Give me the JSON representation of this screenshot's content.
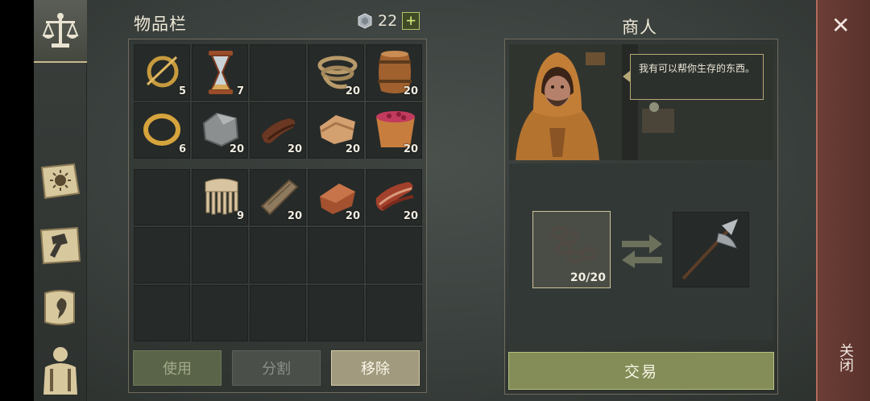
{
  "inventory": {
    "title": "物品栏",
    "currency": {
      "icon": "silver-coin-icon",
      "amount": "22",
      "add_label": "+"
    },
    "bag_slots": [
      {
        "icon": "brooch-icon",
        "qty": "5"
      },
      {
        "icon": "hourglass-icon",
        "qty": "7"
      },
      {
        "icon": "",
        "qty": ""
      },
      {
        "icon": "rope-icon",
        "qty": "20"
      },
      {
        "icon": "barrel-icon",
        "qty": "20"
      },
      {
        "icon": "gold-ring-icon",
        "qty": "6"
      },
      {
        "icon": "stone-icon",
        "qty": "20"
      },
      {
        "icon": "leather-strap-icon",
        "qty": "20"
      },
      {
        "icon": "cloth-icon",
        "qty": "20"
      },
      {
        "icon": "berry-bucket-icon",
        "qty": "20"
      }
    ],
    "stash_slots": [
      {
        "icon": "",
        "qty": ""
      },
      {
        "icon": "comb-icon",
        "qty": "9"
      },
      {
        "icon": "wooden-plank-icon",
        "qty": "20"
      },
      {
        "icon": "copper-ingot-icon",
        "qty": "20"
      },
      {
        "icon": "meat-icon",
        "qty": "20"
      }
    ],
    "buttons": {
      "use": "使用",
      "split": "分割",
      "remove": "移除"
    }
  },
  "merchant": {
    "title": "商人",
    "dialogue": "我有可以帮你生存的东西。",
    "offer": {
      "icon": "chain-icon",
      "qty": "20/20"
    },
    "receive": {
      "icon": "halberd-icon"
    },
    "trade_button": "交易"
  },
  "close": {
    "x_label": "✕",
    "label": "关闭"
  },
  "colors": {
    "accent_green": "#848d58",
    "close_red": "#6b3e36",
    "gold_border": "#cfc39b"
  }
}
